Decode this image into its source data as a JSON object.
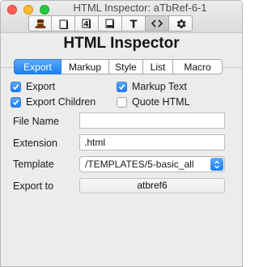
{
  "window": {
    "title": "HTML Inspector: aTbRef-6-1"
  },
  "toolbar": {
    "buttons": [
      {
        "icon": "hat-icon"
      },
      {
        "icon": "note-icon"
      },
      {
        "icon": "attributes-icon",
        "glyph": "4"
      },
      {
        "icon": "action-icon"
      },
      {
        "icon": "text-icon",
        "glyph": "T"
      },
      {
        "icon": "html-icon",
        "glyph": "<>"
      },
      {
        "icon": "gear-icon",
        "glyph": "⚙"
      }
    ]
  },
  "inspector": {
    "heading": "HTML Inspector"
  },
  "tabs": [
    "Export",
    "Markup",
    "Style",
    "List",
    "Macro"
  ],
  "checkboxes": {
    "export": {
      "label": "Export",
      "checked": true
    },
    "markup_text": {
      "label": "Markup Text",
      "checked": true
    },
    "export_children": {
      "label": "Export Children",
      "checked": true
    },
    "quote_html": {
      "label": "Quote HTML",
      "checked": false
    }
  },
  "fields": {
    "file_name": {
      "label": "File Name",
      "value": ""
    },
    "extension": {
      "label": "Extension",
      "value": ".html"
    },
    "template": {
      "label": "Template",
      "value": "/TEMPLATES/5-basic_all"
    },
    "export_to": {
      "label": "Export to",
      "value": "atbref6"
    }
  },
  "colors": {
    "accent": "#1c7ff0"
  }
}
